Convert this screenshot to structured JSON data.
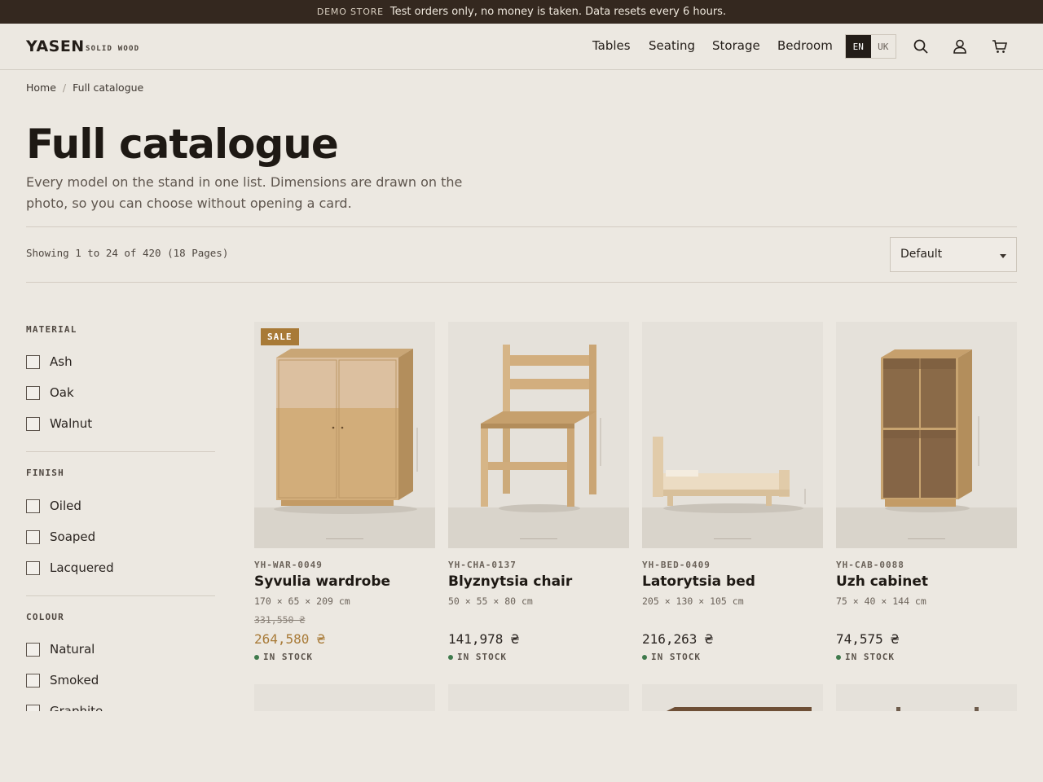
{
  "promo": {
    "tag": "DEMO STORE",
    "text": "Test orders only, no money is taken. Data resets every 6 hours."
  },
  "header": {
    "logo": "YASEN",
    "logo_sub": "SOLID WOOD",
    "nav": [
      "Tables",
      "Seating",
      "Storage",
      "Bedroom"
    ],
    "lang": {
      "active": "EN",
      "other": "UK"
    },
    "icons": [
      "search-icon",
      "account-icon",
      "cart-icon"
    ]
  },
  "breadcrumb": {
    "home": "Home",
    "separator": "/",
    "current": "Full catalogue"
  },
  "page": {
    "title": "Full catalogue",
    "intro": "Every model on the stand in one list. Dimensions are drawn on the photo, so you can choose without opening a card."
  },
  "toolbar": {
    "count": "Showing 1 to 24 of 420 (18 Pages)",
    "sort_value": "Default"
  },
  "filters": [
    {
      "title": "MATERIAL",
      "options": [
        "Ash",
        "Oak",
        "Walnut"
      ]
    },
    {
      "title": "FINISH",
      "options": [
        "Oiled",
        "Soaped",
        "Lacquered"
      ]
    },
    {
      "title": "COLOUR",
      "options": [
        "Natural",
        "Smoked",
        "Graphite"
      ]
    }
  ],
  "products": [
    {
      "sku": "YH-WAR-0049",
      "name": "Syvulia wardrobe",
      "dims": "170 × 65 × 209 cm",
      "old_price": "331,550 ₴",
      "price": "264,580 ₴",
      "badge": "SALE",
      "stock": "IN STOCK"
    },
    {
      "sku": "YH-CHA-0137",
      "name": "Blyznytsia chair",
      "dims": "50 × 55 × 80 cm",
      "price": "141,978 ₴",
      "stock": "IN STOCK"
    },
    {
      "sku": "YH-BED-0409",
      "name": "Latorytsia bed",
      "dims": "205 × 130 × 105 cm",
      "price": "216,263 ₴",
      "stock": "IN STOCK"
    },
    {
      "sku": "YH-CAB-0088",
      "name": "Uzh cabinet",
      "dims": "75 × 40 × 144 cm",
      "price": "74,575 ₴",
      "stock": "IN STOCK"
    }
  ],
  "colors": {
    "promo_bg": "#34281f",
    "page_bg": "#ece8e1",
    "accent": "#a87a37",
    "stock_dot": "#3f7a4c"
  }
}
